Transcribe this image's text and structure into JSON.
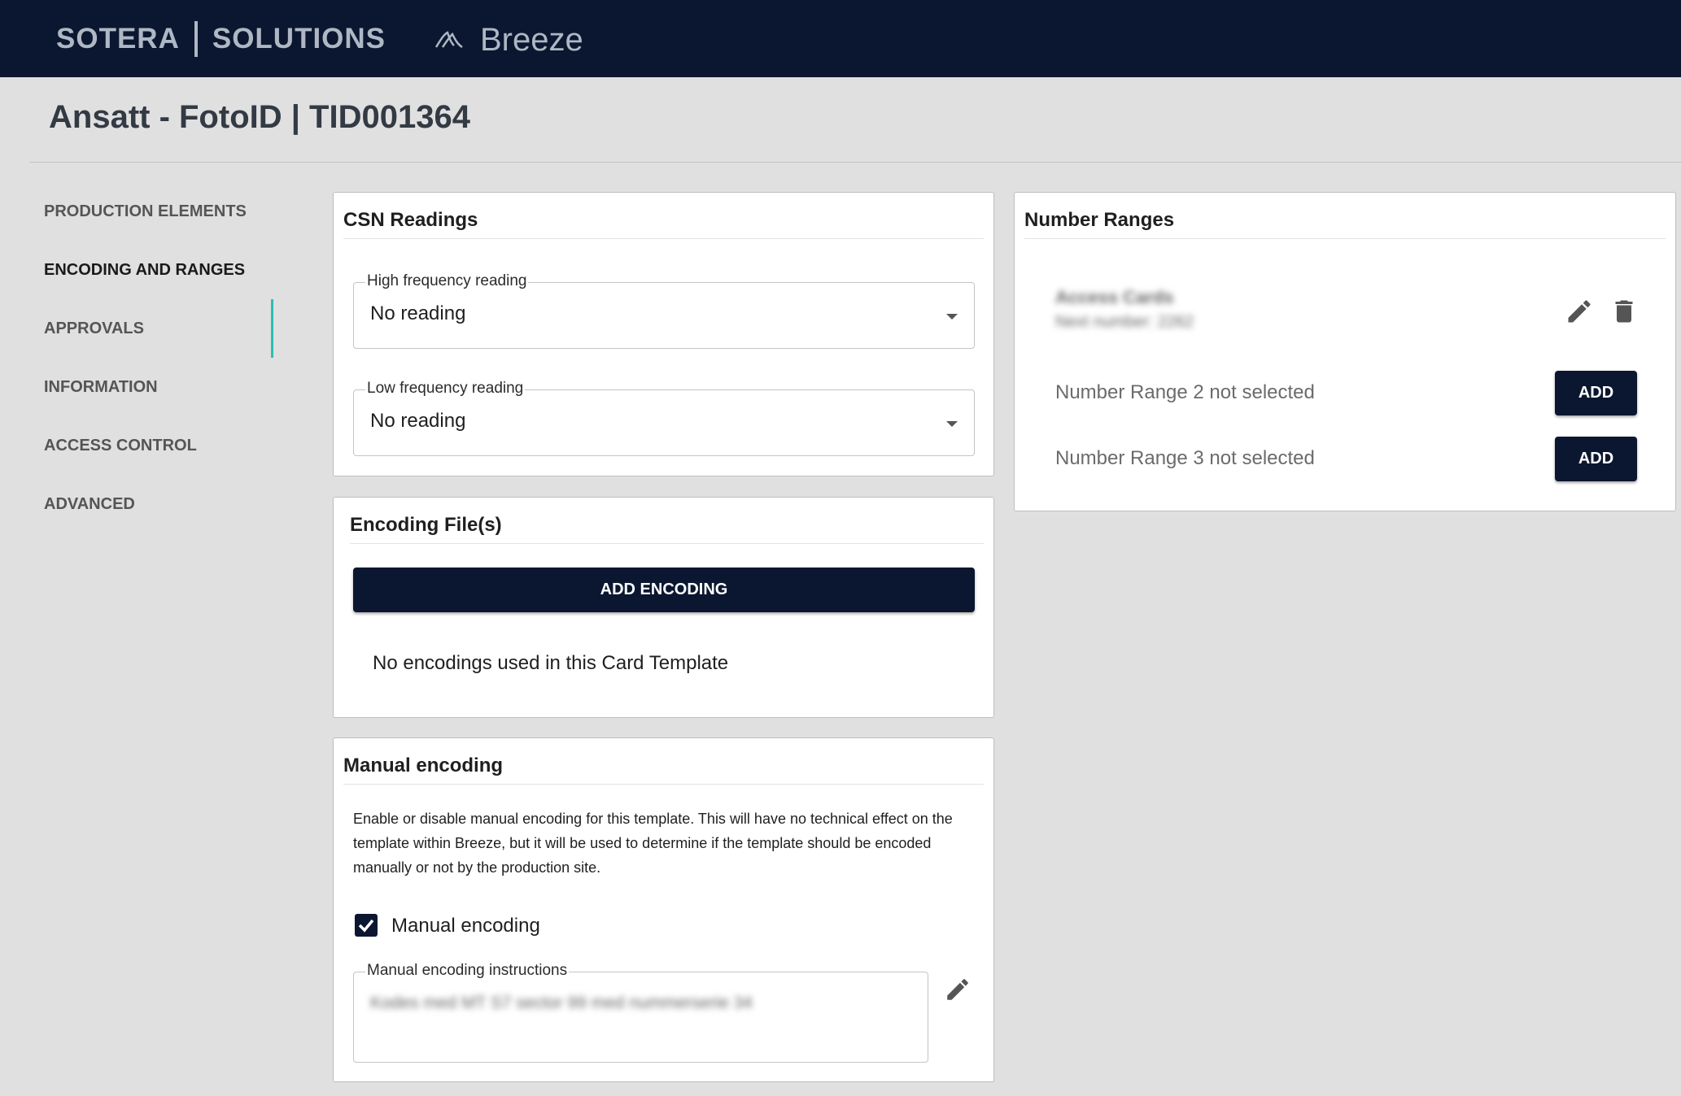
{
  "header": {
    "brand_left": "SOTERA",
    "brand_right": "SOLUTIONS",
    "product_name": "Breeze"
  },
  "page": {
    "title": "Ansatt - FotoID | TID001364"
  },
  "sidebar": {
    "items": [
      {
        "label": "PRODUCTION ELEMENTS"
      },
      {
        "label": "ENCODING AND RANGES"
      },
      {
        "label": "APPROVALS"
      },
      {
        "label": "INFORMATION"
      },
      {
        "label": "ACCESS CONTROL"
      },
      {
        "label": "ADVANCED"
      }
    ],
    "active_index": 1
  },
  "csn": {
    "title": "CSN Readings",
    "high": {
      "label": "High frequency reading",
      "value": "No reading"
    },
    "low": {
      "label": "Low frequency reading",
      "value": "No reading"
    }
  },
  "encoding_files": {
    "title": "Encoding File(s)",
    "add_button": "ADD ENCODING",
    "empty_text": "No encodings used in this Card Template"
  },
  "manual_encoding": {
    "title": "Manual encoding",
    "description": "Enable or disable manual encoding for this template. This will have no technical effect on the template within Breeze, but it will be used to determine if the template should be encoded manually or not by the production site.",
    "checkbox_label": "Manual encoding",
    "checked": true,
    "instructions_label": "Manual encoding instructions",
    "instructions_value": "Kodes med MT S7 sector 99 med nummerserie 34"
  },
  "number_ranges": {
    "title": "Number Ranges",
    "range1": {
      "name": "Access Cards",
      "next": "Next number: 2262"
    },
    "range2": {
      "text": "Number Range 2 not selected",
      "button": "ADD"
    },
    "range3": {
      "text": "Number Range 3 not selected",
      "button": "ADD"
    }
  },
  "colors": {
    "topbar": "#0b1730",
    "accent": "#2bbfb3",
    "button": "#0b1730"
  }
}
